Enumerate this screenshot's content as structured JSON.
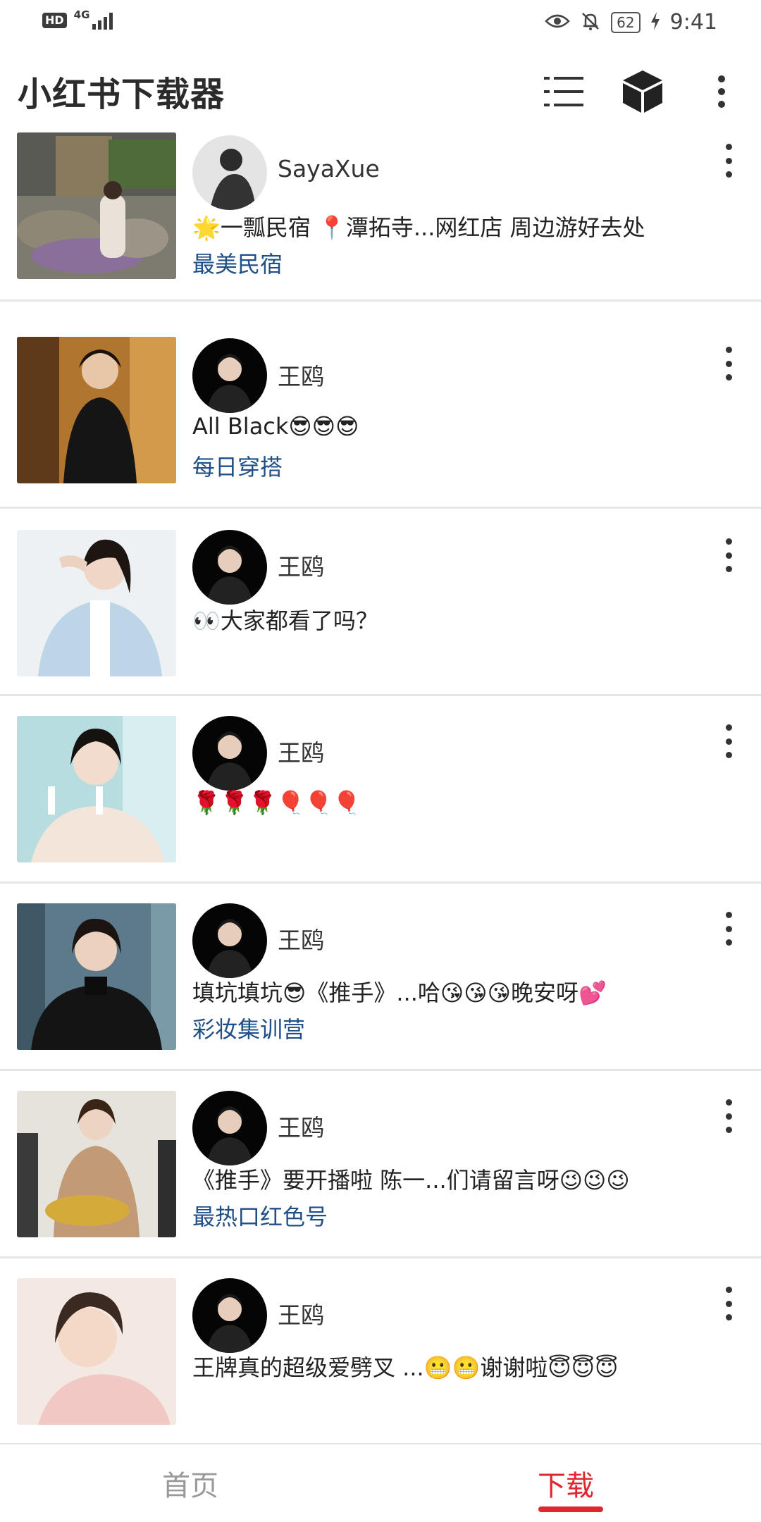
{
  "status_bar": {
    "hd": "HD",
    "network": "4G",
    "battery": "62",
    "time": "9:41"
  },
  "app_bar": {
    "title": "小红书下载器",
    "icons": [
      "list-icon",
      "cube-icon",
      "more-vertical-icon"
    ]
  },
  "feed": {
    "items": [
      {
        "author": "SayaXue",
        "title": "🌟一瓢民宿 📍潭拓寺...网红店 周边游好去处",
        "tag": "最美民宿"
      },
      {
        "author": "王鸥",
        "title": "All Black😎😎😎",
        "tag": "每日穿搭"
      },
      {
        "author": "王鸥",
        "title": "👀大家都看了吗？",
        "tag": ""
      },
      {
        "author": "王鸥",
        "title": "🌹🌹🌹🎈🎈🎈",
        "tag": ""
      },
      {
        "author": "王鸥",
        "title": "填坑填坑😎《推手》...哈😘😘😘晚安呀💕",
        "tag": "彩妆集训营"
      },
      {
        "author": "王鸥",
        "title": "《推手》要开播啦 陈一...们请留言呀😉😉😉",
        "tag": "最热口红色号"
      },
      {
        "author": "王鸥",
        "title": "王牌真的超级爱劈叉 ...😬😬谢谢啦😇😇😇",
        "tag": ""
      }
    ]
  },
  "bottom_nav": {
    "home": "首页",
    "download": "下载"
  },
  "colors": {
    "accent": "#e0262e",
    "tag": "#1f4f86",
    "divider": "#e6e6e6"
  }
}
